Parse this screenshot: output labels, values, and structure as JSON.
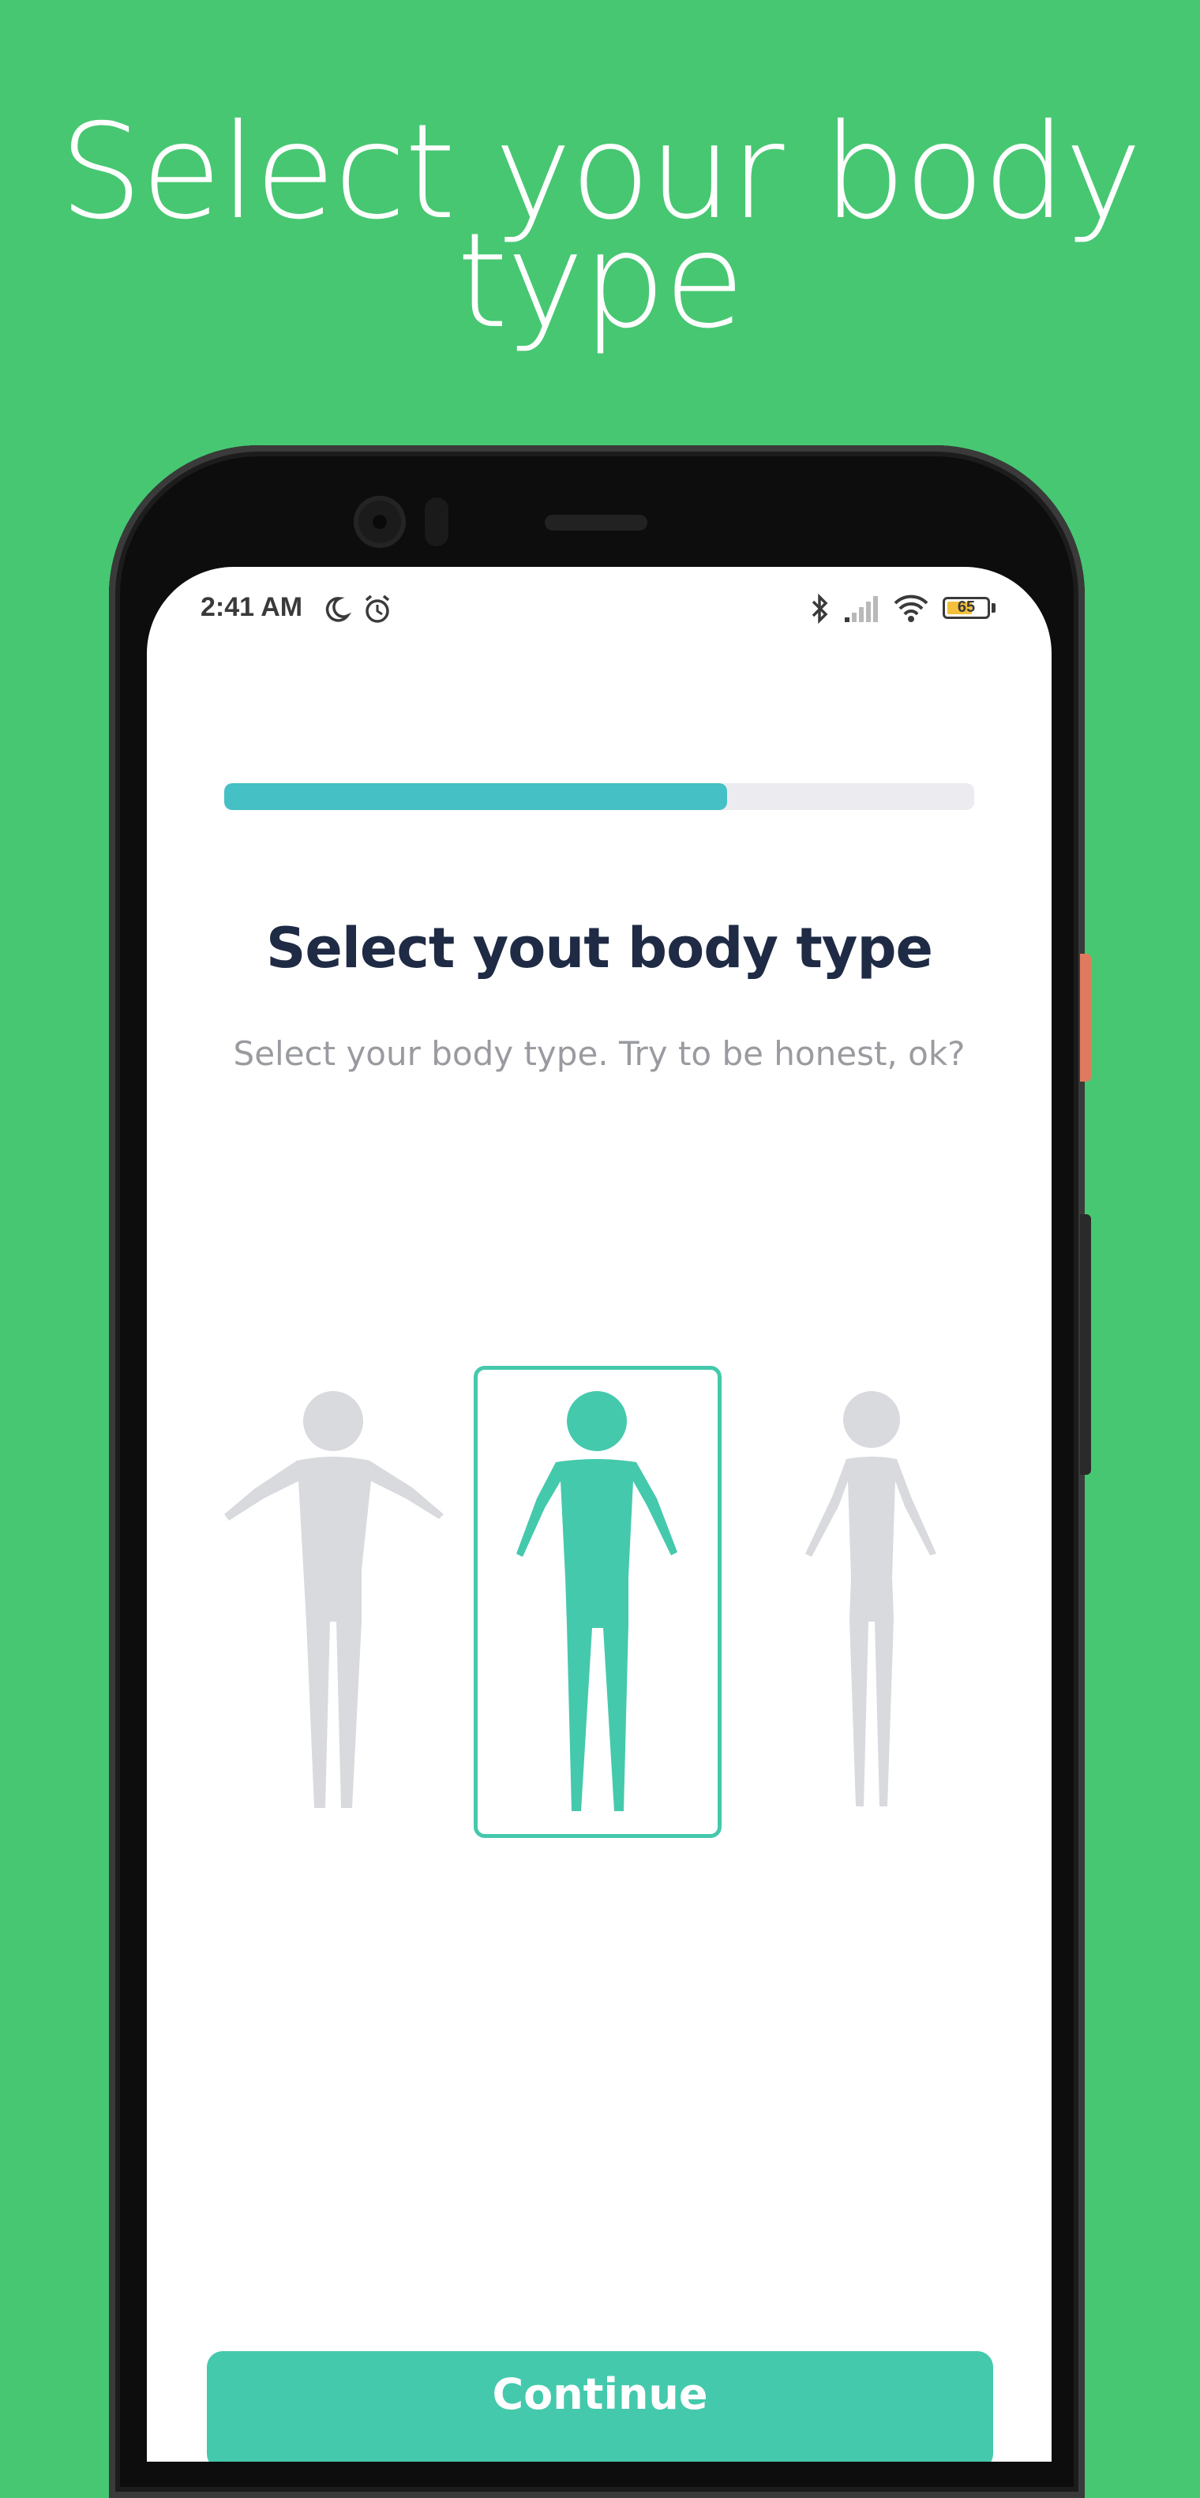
{
  "promo": {
    "headline_line1": "Select your body",
    "headline_line2": "type"
  },
  "status_bar": {
    "time": "2:41 AM",
    "icons": [
      "moon-icon",
      "alarm-icon",
      "bluetooth-icon",
      "signal-icon",
      "wifi-icon"
    ],
    "battery_level": "65"
  },
  "progress": {
    "fraction": 0.67
  },
  "screen": {
    "title": "Select yout body type",
    "subtitle": "Select your body type. Try to be honest, ok?"
  },
  "body_types": {
    "options": [
      "broad-body-figure",
      "average-body-figure",
      "slim-body-figure"
    ],
    "selected_index": 1
  },
  "cta": {
    "label": "Continue"
  },
  "colors": {
    "background": "#48c772",
    "accent": "#45c9ad",
    "progress": "#45c1c6",
    "inactive_figure": "#d9dadd",
    "title": "#1f2a44",
    "subtitle": "#9a9ba1"
  }
}
